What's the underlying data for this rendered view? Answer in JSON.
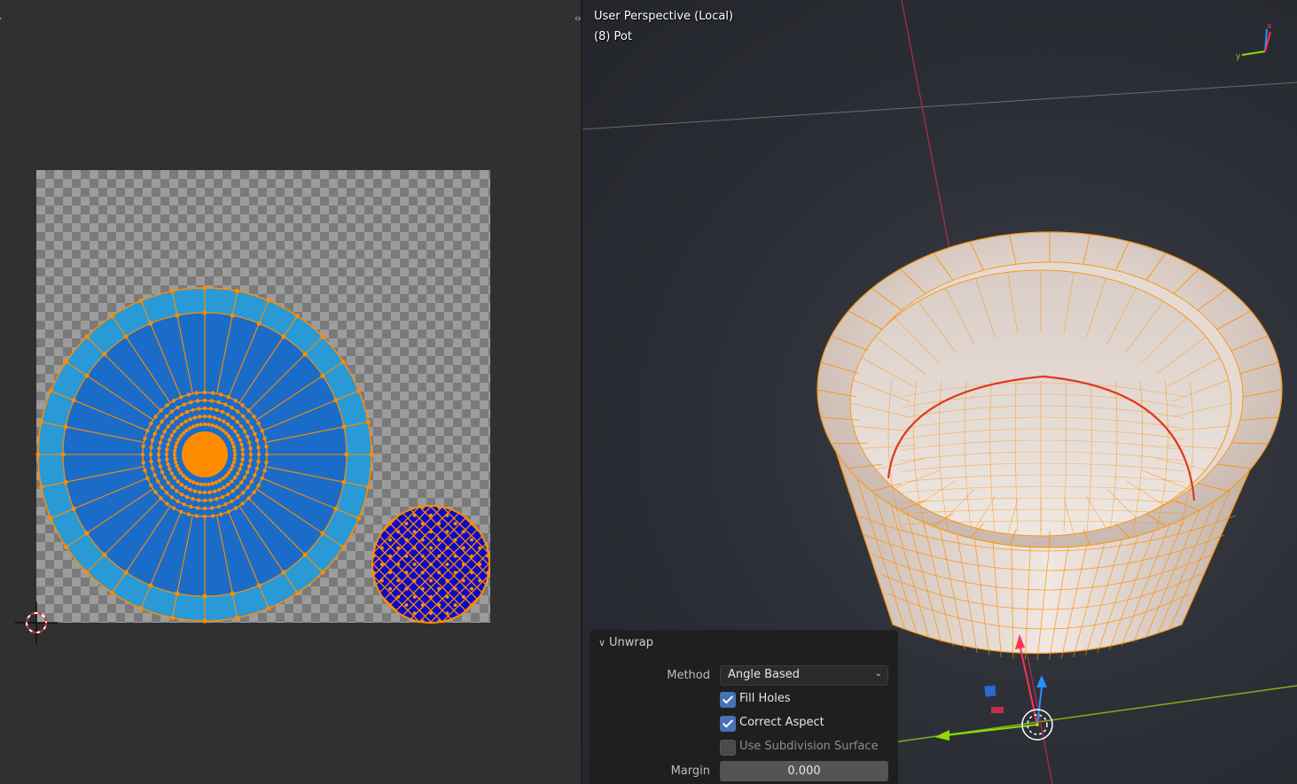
{
  "viewport": {
    "title": "User Perspective (Local)",
    "object_label": "(8) Pot"
  },
  "unwrap_panel": {
    "header": "Unwrap",
    "method_label": "Method",
    "method_value": "Angle Based",
    "fill_holes_label": "Fill Holes",
    "fill_holes_checked": true,
    "correct_aspect_label": "Correct Aspect",
    "correct_aspect_checked": true,
    "use_subdivision_label": "Use Subdivision Surface",
    "use_subdivision_checked": false,
    "margin_label": "Margin",
    "margin_value": "0.000"
  },
  "colors": {
    "uv_edge": "#ff8c00",
    "uv_face_fill": "#1a75d2",
    "pot_surface": "#e8ddd6",
    "x_axis": "#ff3352",
    "y_axis": "#8bdc00",
    "z_axis": "#2890ff"
  },
  "icons": [
    "cursor-crosshair-icon",
    "split-arrows-icon",
    "chevron-down-icon",
    "navigation-gizmo-icon",
    "transform-gizmo-icon"
  ]
}
